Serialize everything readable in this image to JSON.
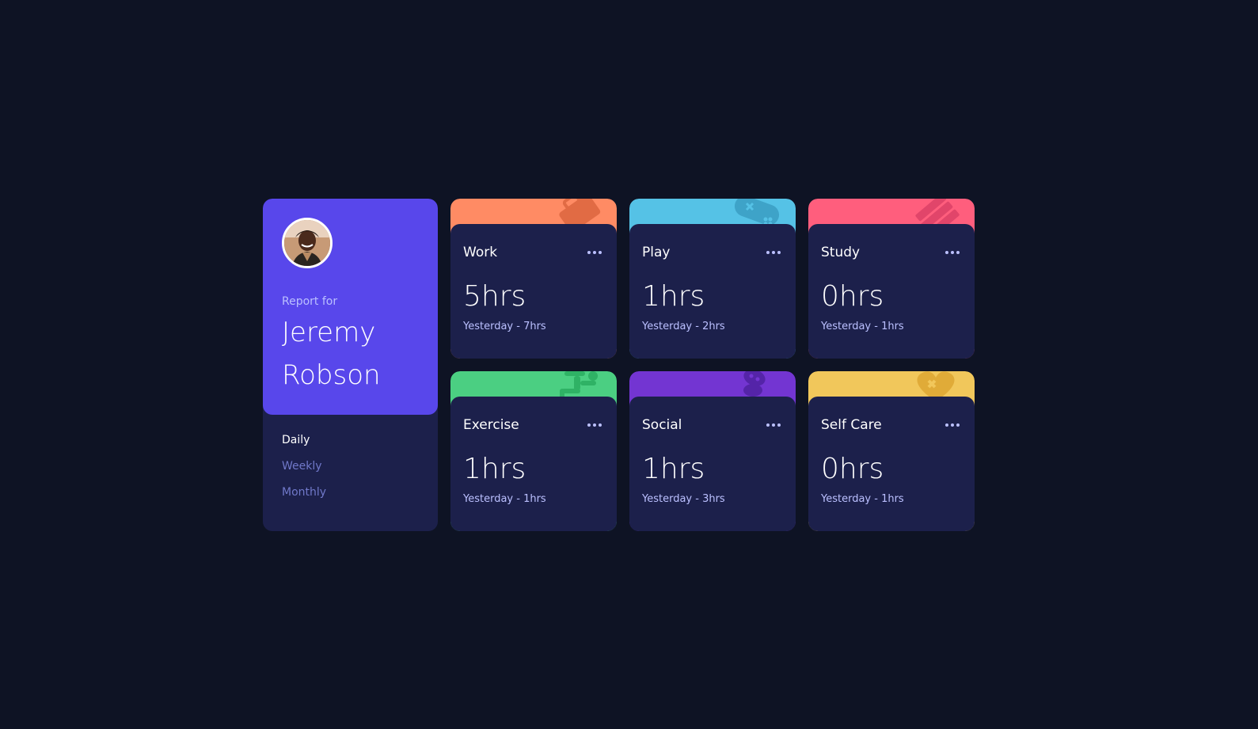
{
  "profile": {
    "report_label": "Report for",
    "first_name": "Jeremy",
    "last_name": "Robson",
    "avatar_icon": "user-avatar"
  },
  "periods": [
    {
      "label": "Daily",
      "active": true
    },
    {
      "label": "Weekly",
      "active": false
    },
    {
      "label": "Monthly",
      "active": false
    }
  ],
  "cards": [
    {
      "title": "Work",
      "current": "5hrs",
      "previous": "Yesterday - 7hrs",
      "color": "#ff8b64",
      "icon": "briefcase-icon"
    },
    {
      "title": "Play",
      "current": "1hrs",
      "previous": "Yesterday - 2hrs",
      "color": "#55c2e6",
      "icon": "gamepad-icon"
    },
    {
      "title": "Study",
      "current": "0hrs",
      "previous": "Yesterday - 1hrs",
      "color": "#ff5e7d",
      "icon": "book-icon"
    },
    {
      "title": "Exercise",
      "current": "1hrs",
      "previous": "Yesterday - 1hrs",
      "color": "#4bcf82",
      "icon": "running-icon"
    },
    {
      "title": "Social",
      "current": "1hrs",
      "previous": "Yesterday - 3hrs",
      "color": "#7335d2",
      "icon": "social-icon"
    },
    {
      "title": "Self Care",
      "current": "0hrs",
      "previous": "Yesterday - 1hrs",
      "color": "#f1c75b",
      "icon": "heart-icon"
    }
  ],
  "colors": {
    "background": "#0e1324",
    "card": "#1c204b",
    "accent": "#5847eb",
    "muted_text": "#bbc0ff"
  }
}
